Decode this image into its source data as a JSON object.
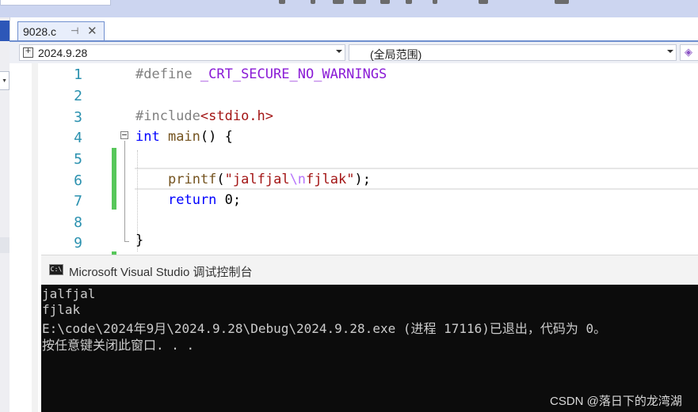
{
  "tab": {
    "filename": "9028.c",
    "pin_icon": "pin-icon",
    "close_icon": "close-icon"
  },
  "navigation": {
    "project": "2024.9.28",
    "scope": "(全局范围)"
  },
  "editor": {
    "line_numbers": [
      "1",
      "2",
      "3",
      "4",
      "5",
      "6",
      "7",
      "8",
      "9"
    ],
    "lines": {
      "l1_directive": "#define ",
      "l1_macro": "_CRT_SECURE_NO_WARNINGS",
      "l3_directive": "#include",
      "l3_header": "<stdio.h>",
      "l4_keyword": "int",
      "l4_name": " main",
      "l4_rest": "() {",
      "l6_func": "printf",
      "l6_open": "(",
      "l6_str_a": "\"jalfjal",
      "l6_escape": "\\n",
      "l6_str_b": "fjlak\"",
      "l6_close": ");",
      "l7_keyword": "return",
      "l7_rest": " 0;",
      "l9_brace": "}"
    }
  },
  "console": {
    "title": "Microsoft Visual Studio 调试控制台",
    "icon_text": "C:\\",
    "output": [
      "jalfjal",
      "fjlak",
      "E:\\code\\2024年9月\\2024.9.28\\Debug\\2024.9.28.exe (进程 17116)已退出，代码为 0。",
      "按任意键关闭此窗口. . ."
    ]
  },
  "watermark": "CSDN @落日下的龙湾湖",
  "colors": {
    "keyword": "#0000ff",
    "macro": "#8a1bd6",
    "string": "#a31515",
    "line_number": "#2b91af",
    "change_marker": "#57c75a"
  }
}
